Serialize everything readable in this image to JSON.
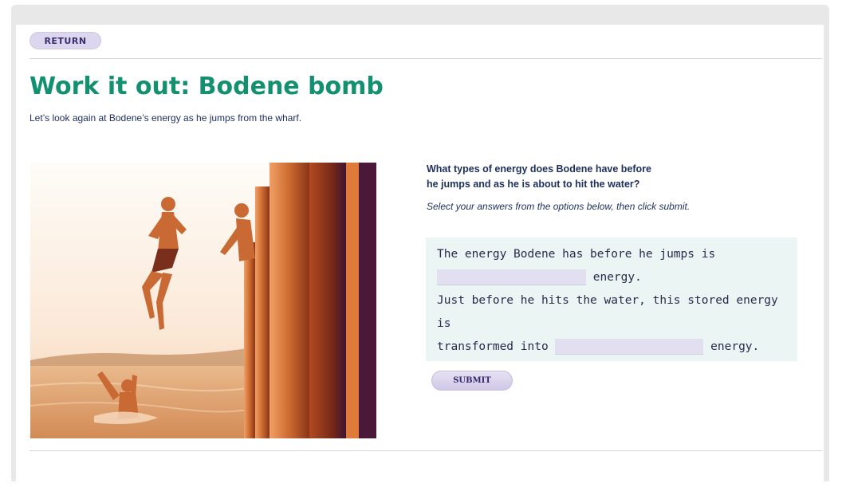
{
  "nav": {
    "return_label": "RETURN"
  },
  "page": {
    "title": "Work it out: Bodene bomb",
    "subtitle": "Let’s look again at Bodene’s energy as he jumps from the wharf."
  },
  "question": {
    "line1": "What types of energy does Bodene have before",
    "line2": "he jumps and as he is about to hit the water?",
    "instruction": "Select your answers from the options below, then click submit."
  },
  "answers": {
    "text_before_jump": "The energy Bodene has before he jumps is",
    "energy_word_1": "energy.",
    "text_before_water": "Just before he hits the water, this stored energy is",
    "transformed_into": "transformed into",
    "energy_word_2": "energy.",
    "blank1_value": "",
    "blank2_value": ""
  },
  "actions": {
    "submit_label": "SUBMIT"
  },
  "colors": {
    "title": "#12906f",
    "button_bg": "#dcd6ee",
    "answer_bg": "#ebf5f3"
  }
}
